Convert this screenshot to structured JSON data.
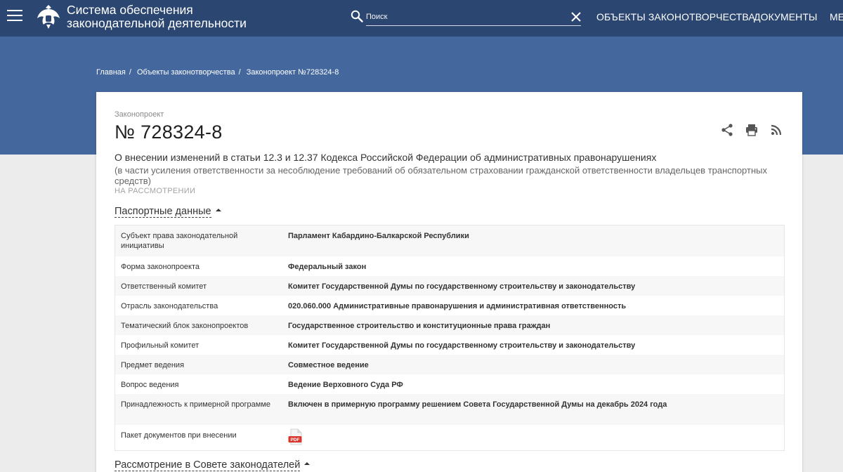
{
  "header": {
    "site_title_line1": "Система обеспечения",
    "site_title_line2": "законодательной деятельности",
    "search_placeholder": "Поиск",
    "nav": [
      "ОБЪЕКТЫ ЗАКОНОТВОРЧЕСТВА",
      "ДОКУМЕНТЫ",
      "МЕ"
    ]
  },
  "breadcrumb": [
    "Главная",
    "Объекты законотворчества",
    "Законопроект №728324-8"
  ],
  "bill": {
    "kind": "Законопроект",
    "number": "№ 728324-8",
    "title": "О внесении изменений в статьи 12.3 и 12.37 Кодекса Российской Федерации об административных правонарушениях",
    "subtitle": "(в части усиления ответственности за несоблюдение требований об обязательном страховании гражданской ответственности владельцев транспортных средств)",
    "status": "НА РАССМОТРЕНИИ"
  },
  "sections": {
    "passport": "Паспортные данные",
    "council": "Рассмотрение в Совете законодателей"
  },
  "passport_rows": [
    {
      "key": "Субъект права законодательной инициативы",
      "value": "Парламент Кабардино-Балкарской Республики"
    },
    {
      "key": "Форма законопроекта",
      "value": "Федеральный закон"
    },
    {
      "key": "Ответственный комитет",
      "value": "Комитет Государственной Думы по государственному строительству и законодательству"
    },
    {
      "key": "Отрасль законодательства",
      "value": "020.060.000 Административные правонарушения и административная ответственность"
    },
    {
      "key": "Тематический блок законопроектов",
      "value": "Государственное строительство и конституционные права граждан"
    },
    {
      "key": "Профильный комитет",
      "value": "Комитет Государственной Думы по государственному строительству и законодательству"
    },
    {
      "key": "Предмет ведения",
      "value": "Совместное ведение"
    },
    {
      "key": "Вопрос ведения",
      "value": "Ведение Верховного Суда РФ"
    },
    {
      "key": "Принадлежность к примерной программе",
      "value": "Включен в примерную программу решением Совета Государственной Думы на декабрь 2024 года"
    },
    {
      "key": "Пакет документов при внесении",
      "value": ""
    }
  ],
  "pdf_label": "PDF",
  "colors": {
    "header": "#2b4670",
    "band": "#44689e",
    "pdf_red": "#d9362b"
  }
}
